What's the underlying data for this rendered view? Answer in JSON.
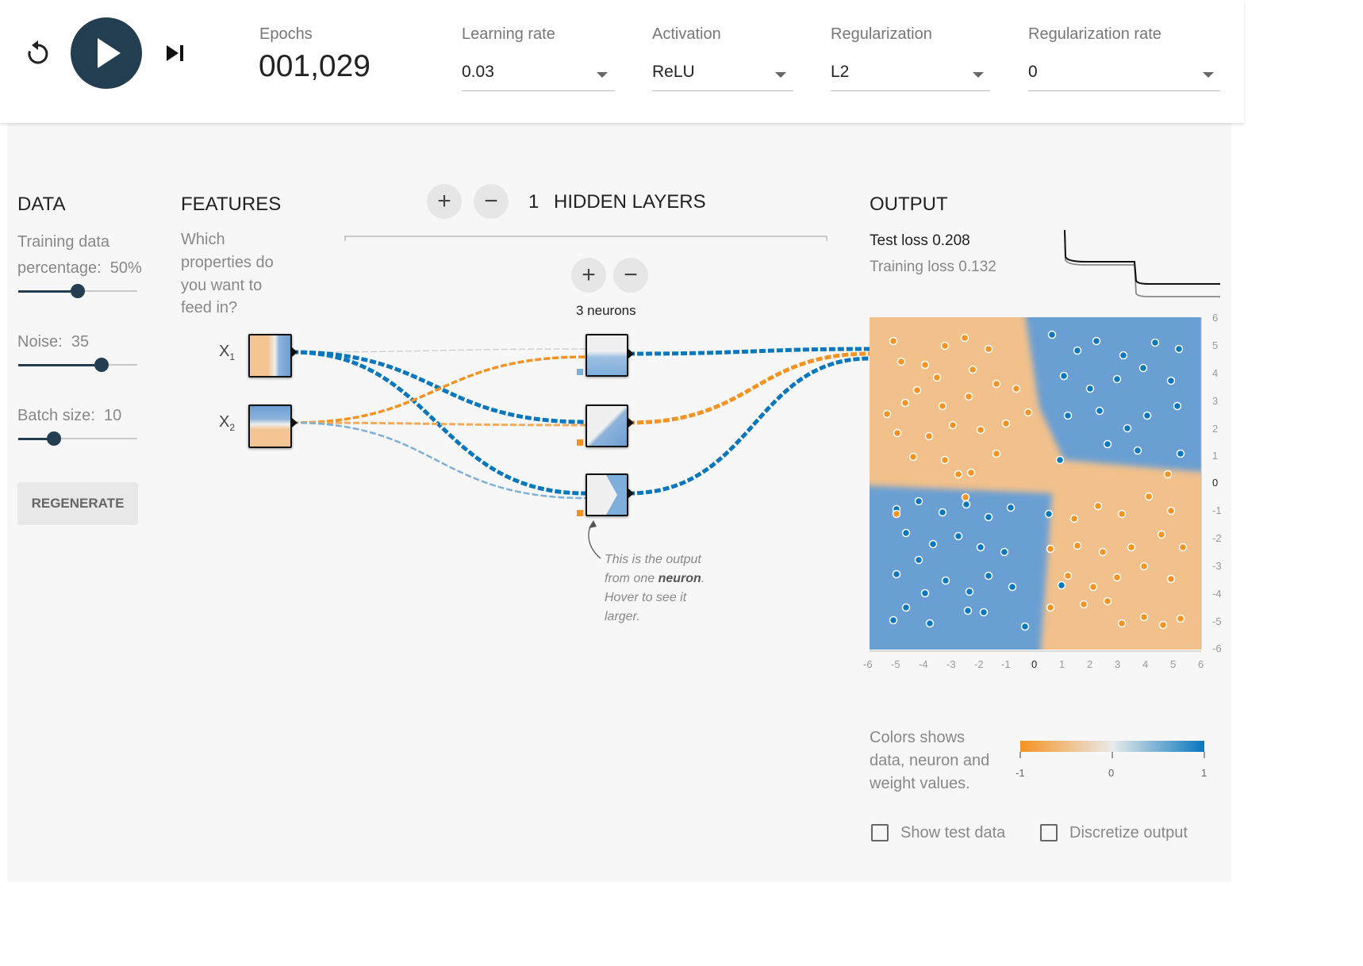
{
  "topbar": {
    "epochs_label": "Epochs",
    "epochs_value": "001,029",
    "learning_rate": {
      "label": "Learning rate",
      "value": "0.03"
    },
    "activation": {
      "label": "Activation",
      "value": "ReLU"
    },
    "regularization": {
      "label": "Regularization",
      "value": "L2"
    },
    "regularization_rate": {
      "label": "Regularization rate",
      "value": "0"
    }
  },
  "data_panel": {
    "title": "DATA",
    "training_label": "Training data",
    "percentage_label": "percentage:",
    "percentage_value": "50%",
    "percentage_fraction": 0.5,
    "noise_label": "Noise:",
    "noise_value": "35",
    "noise_fraction": 0.7,
    "batch_label": "Batch size:",
    "batch_value": "10",
    "batch_fraction": 0.3,
    "regenerate_label": "REGENERATE"
  },
  "features": {
    "title": "FEATURES",
    "line1": "Which",
    "line2": "properties do",
    "line3": "you want to",
    "line4": "feed in?",
    "x1": "X",
    "x1_sub": "1",
    "x2": "X",
    "x2_sub": "2"
  },
  "hidden": {
    "plus": "+",
    "minus": "−",
    "count": "1",
    "label": "HIDDEN LAYERS",
    "neurons_label": "3 neurons"
  },
  "annotation": {
    "line1": "This is the output",
    "line2a": "from one ",
    "line2b": "neuron",
    "line2c": ".",
    "line3": "Hover to see it",
    "line4": "larger."
  },
  "output": {
    "title": "OUTPUT",
    "test_loss": "Test loss 0.208",
    "training_loss": "Training loss 0.132",
    "y_ticks": [
      "6",
      "5",
      "4",
      "3",
      "2",
      "1",
      "0",
      "-1",
      "-2",
      "-3",
      "-4",
      "-5",
      "-6"
    ],
    "x_ticks": [
      "-6",
      "-5",
      "-4",
      "-3",
      "-2",
      "-1",
      "0",
      "1",
      "2",
      "3",
      "4",
      "5",
      "6"
    ],
    "legend_line1": "Colors shows",
    "legend_line2": "data, neuron and",
    "legend_line3": "weight values.",
    "legend_min": "-1",
    "legend_mid": "0",
    "legend_max": "1",
    "show_test_data": "Show test data",
    "discretize_output": "Discretize output"
  },
  "colors": {
    "orange": "#f59322",
    "blue": "#0877bd",
    "dark_button": "#233e51"
  },
  "icons": [
    "reset-icon",
    "play-icon",
    "step-icon",
    "chevron-down-icon"
  ]
}
